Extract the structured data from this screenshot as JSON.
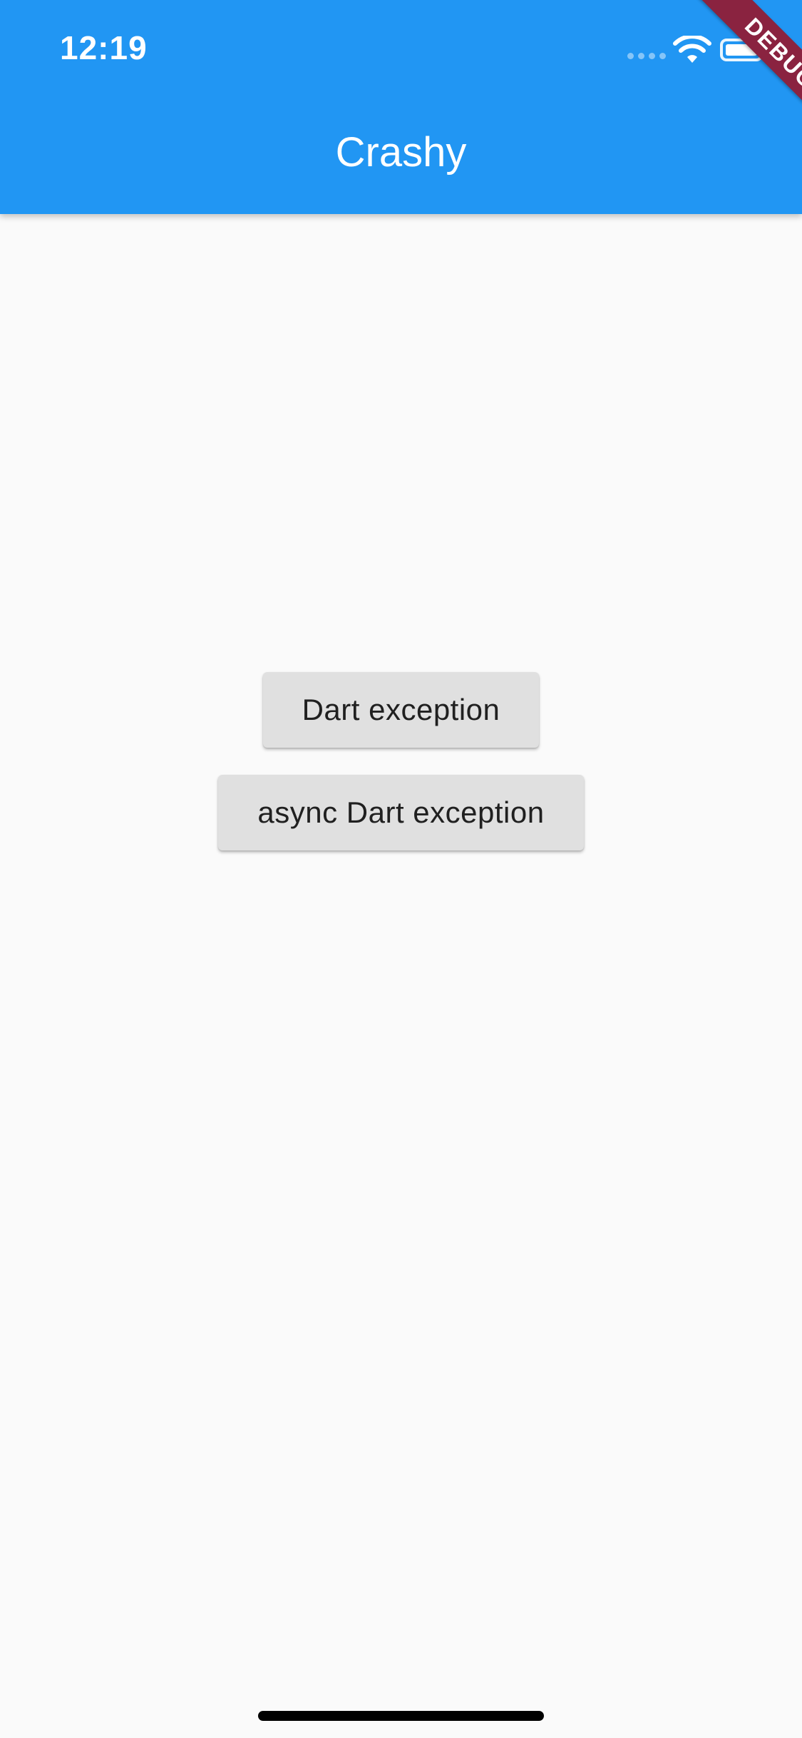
{
  "status_bar": {
    "time": "12:19",
    "icons": [
      "signal-dots-icon",
      "wifi-icon",
      "battery-icon"
    ]
  },
  "app_bar": {
    "title": "Crashy",
    "color": "#2196f3"
  },
  "debug_banner": {
    "label": "DEBUG",
    "color": "#8a2340"
  },
  "buttons": {
    "dart_exception": "Dart exception",
    "async_dart_exception": "async Dart exception"
  }
}
